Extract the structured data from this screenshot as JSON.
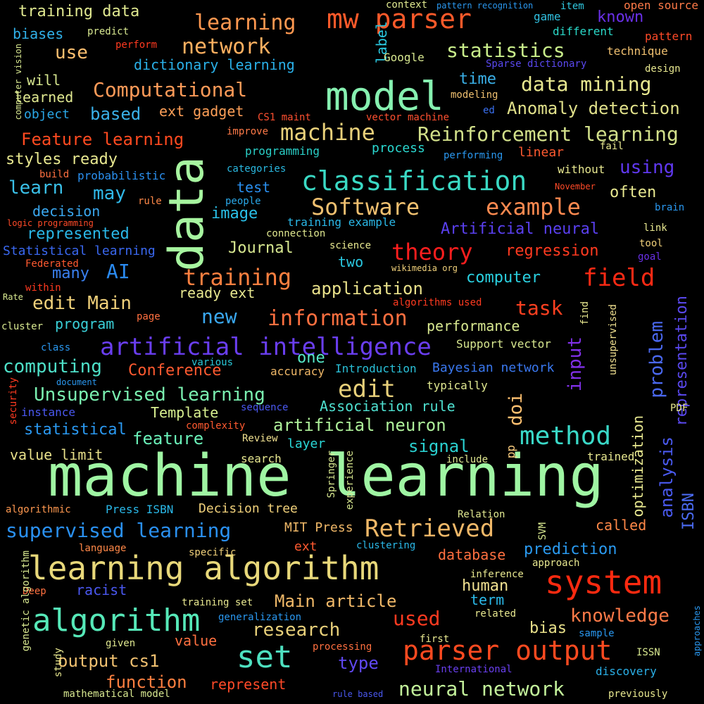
{
  "colors": {
    "background": "#000000"
  },
  "words": [
    {
      "text": "machine learning",
      "color": "#9ff5a3"
    },
    {
      "text": "data",
      "color": "#a7f5a0"
    },
    {
      "text": "model",
      "color": "#86f0b0"
    },
    {
      "text": "learning algorithm",
      "color": "#e8d87a"
    },
    {
      "text": "system",
      "color": "#ff2a10"
    },
    {
      "text": "algorithm",
      "color": "#56e8b8"
    },
    {
      "text": "parser output",
      "color": "#ff4a20"
    },
    {
      "text": "classification",
      "color": "#3ad9c4"
    },
    {
      "text": "artificial intelligence",
      "color": "#6a3ef0"
    },
    {
      "text": "mw parser",
      "color": "#ff5a2a"
    },
    {
      "text": "Software",
      "color": "#f0c070"
    },
    {
      "text": "example",
      "color": "#ff8a50"
    },
    {
      "text": "machine",
      "color": "#e8d07a"
    },
    {
      "text": "Reinforcement learning",
      "color": "#d2e08a"
    },
    {
      "text": "set",
      "color": "#4ee0c0"
    },
    {
      "text": "Retrieved",
      "color": "#f0b868"
    },
    {
      "text": "method",
      "color": "#3ad9c8"
    },
    {
      "text": "theory",
      "color": "#ff1e1e"
    },
    {
      "text": "field",
      "color": "#ff2a14"
    },
    {
      "text": "training",
      "color": "#ff8040"
    },
    {
      "text": "information",
      "color": "#ff7040"
    },
    {
      "text": "edit",
      "color": "#e8d07a"
    },
    {
      "text": "supervised learning",
      "color": "#2a90f0"
    },
    {
      "text": "Unsupervised learning",
      "color": "#7af0b0"
    },
    {
      "text": "learning",
      "color": "#ff9850"
    },
    {
      "text": "network",
      "color": "#ffb060"
    },
    {
      "text": "statistics",
      "color": "#c8ec8a"
    },
    {
      "text": "data mining",
      "color": "#e8e890"
    },
    {
      "text": "Computational",
      "color": "#ff9a58"
    },
    {
      "text": "neural network",
      "color": "#c2f09a"
    },
    {
      "text": "research",
      "color": "#e8d07a"
    },
    {
      "text": "knowledge",
      "color": "#ff7a48"
    },
    {
      "text": "Main article",
      "color": "#f0b868"
    },
    {
      "text": "output cs1",
      "color": "#f0c070"
    },
    {
      "text": "function",
      "color": "#ff8040"
    },
    {
      "text": "computing",
      "color": "#4ee0c8"
    },
    {
      "text": "edit Main",
      "color": "#f0d07a"
    },
    {
      "text": "artificial neuron",
      "color": "#aef09a"
    },
    {
      "text": "feature",
      "color": "#6af0b8"
    },
    {
      "text": "Anomaly detection",
      "color": "#e0e08a"
    },
    {
      "text": "Feature learning",
      "color": "#ff4a20"
    },
    {
      "text": "application",
      "color": "#e8e08a"
    },
    {
      "text": "Journal",
      "color": "#d8e890"
    },
    {
      "text": "task",
      "color": "#ff4020"
    },
    {
      "text": "representation",
      "color": "#5a48ee"
    },
    {
      "text": "problem",
      "color": "#4a68f0"
    },
    {
      "text": "analysis",
      "color": "#4a5af0"
    },
    {
      "text": "input",
      "color": "#8030e8"
    },
    {
      "text": "used",
      "color": "#ff3a20"
    },
    {
      "text": "regression",
      "color": "#ff3a20"
    },
    {
      "text": "performance",
      "color": "#d8e890"
    },
    {
      "text": "doi",
      "color": "#ffc070"
    },
    {
      "text": "AI",
      "color": "#2a8af0"
    },
    {
      "text": "prediction",
      "color": "#2a9af0"
    },
    {
      "text": "human",
      "color": "#f0e090"
    },
    {
      "text": "bias",
      "color": "#e8e08a"
    },
    {
      "text": "computer",
      "color": "#2ad0e0"
    },
    {
      "text": "ISBN",
      "color": "#4a6af0"
    },
    {
      "text": "training data",
      "color": "#e0e890"
    },
    {
      "text": "use",
      "color": "#ffc070"
    },
    {
      "text": "learn",
      "color": "#3ac0e8"
    },
    {
      "text": "may",
      "color": "#30b8e8"
    },
    {
      "text": "based",
      "color": "#3ab0e8"
    },
    {
      "text": "using",
      "color": "#6038f0"
    },
    {
      "text": "often",
      "color": "#e8e890"
    },
    {
      "text": "statistical",
      "color": "#2a98f0"
    },
    {
      "text": "signal",
      "color": "#2ad0d0"
    },
    {
      "text": "layer",
      "color": "#2ad8d8"
    },
    {
      "text": "value limit",
      "color": "#e8e08a"
    },
    {
      "text": "Template",
      "color": "#d8f090"
    },
    {
      "text": "Association rule",
      "color": "#4ee0d0"
    },
    {
      "text": "Artificial neural",
      "color": "#5a40f0"
    },
    {
      "text": "decision",
      "color": "#3aa8f0"
    },
    {
      "text": "represented",
      "color": "#2ab8e8"
    },
    {
      "text": "image",
      "color": "#2ac0e8"
    },
    {
      "text": "new",
      "color": "#3aa8f0"
    },
    {
      "text": "one",
      "color": "#56e8c8"
    },
    {
      "text": "Conference",
      "color": "#ff5a30"
    },
    {
      "text": "many",
      "color": "#3a80f0"
    },
    {
      "text": "two",
      "color": "#2ac8e0"
    },
    {
      "text": "test",
      "color": "#2a90f0"
    },
    {
      "text": "program",
      "color": "#3ad0d8"
    },
    {
      "text": "time",
      "color": "#3ab0e8"
    },
    {
      "text": "ext gadget",
      "color": "#ffa058"
    },
    {
      "text": "styles ready",
      "color": "#e8e890"
    },
    {
      "text": "ready ext",
      "color": "#e8e890"
    },
    {
      "text": "term",
      "color": "#2ab8e8"
    },
    {
      "text": "type",
      "color": "#6048f0"
    },
    {
      "text": "value",
      "color": "#ff7040"
    },
    {
      "text": "called",
      "color": "#ff8848"
    },
    {
      "text": "database",
      "color": "#ff7040"
    },
    {
      "text": "Bayesian network",
      "color": "#3a78f0"
    },
    {
      "text": "optimization",
      "color": "#e8e890"
    },
    {
      "text": "represent",
      "color": "#ff4a28"
    },
    {
      "text": "process",
      "color": "#2ad8d0"
    },
    {
      "text": "biases",
      "color": "#30b0e8"
    },
    {
      "text": "learned",
      "color": "#e0e890"
    },
    {
      "text": "will",
      "color": "#d8e890"
    },
    {
      "text": "label",
      "color": "#2ac8e0"
    },
    {
      "text": "known",
      "color": "#6a30e8"
    },
    {
      "text": "linear",
      "color": "#ff5a30"
    },
    {
      "text": "dictionary learning",
      "color": "#2ab0e8"
    },
    {
      "text": "Decision tree",
      "color": "#f0d07a"
    },
    {
      "text": "Press ISBN",
      "color": "#2ab8e8"
    },
    {
      "text": "MIT Press",
      "color": "#f0b868"
    },
    {
      "text": "ext",
      "color": "#ff5a30"
    },
    {
      "text": "object",
      "color": "#2aa8e8"
    },
    {
      "text": "racist",
      "color": "#4a58f0"
    },
    {
      "text": "accuracy",
      "color": "#f0b868"
    },
    {
      "text": "typically",
      "color": "#e0e890"
    },
    {
      "text": "Google",
      "color": "#d8e890"
    },
    {
      "text": "discovery",
      "color": "#2ab0e8"
    },
    {
      "text": "training example",
      "color": "#2ab8e8"
    },
    {
      "text": "Support vector",
      "color": "#d8e890"
    },
    {
      "text": "Introduction",
      "color": "#2ac0d8"
    },
    {
      "text": "programming",
      "color": "#2ad0c8"
    },
    {
      "text": "Statistical learning",
      "color": "#3a68f0"
    },
    {
      "text": "probabilistic",
      "color": "#2a90f0"
    },
    {
      "text": "instance",
      "color": "#4a58f0"
    },
    {
      "text": "Springer",
      "color": "#d8e890"
    },
    {
      "text": "experience",
      "color": "#d8e890"
    },
    {
      "text": "search",
      "color": "#e8e890"
    },
    {
      "text": "include",
      "color": "#e0e890"
    },
    {
      "text": "pp",
      "color": "#ffd080"
    },
    {
      "text": "trained",
      "color": "#e8e890"
    },
    {
      "text": "unsupervised",
      "color": "#f0e090"
    },
    {
      "text": "open source",
      "color": "#ff7a48"
    },
    {
      "text": "pattern",
      "color": "#ff4a28"
    },
    {
      "text": "technique",
      "color": "#f0c070"
    },
    {
      "text": "design",
      "color": "#e8e890"
    },
    {
      "text": "item",
      "color": "#30c8e0"
    },
    {
      "text": "game",
      "color": "#30c0e0"
    },
    {
      "text": "different",
      "color": "#2ad8c8"
    },
    {
      "text": "context",
      "color": "#e0e890"
    },
    {
      "text": "pattern recognition",
      "color": "#2a98f0"
    },
    {
      "text": "Sparse dictionary",
      "color": "#5a48f0"
    },
    {
      "text": "modeling",
      "color": "#f0c070"
    },
    {
      "text": "ed",
      "color": "#3a70f0"
    },
    {
      "text": "vector machine",
      "color": "#ff5030"
    },
    {
      "text": "CS1 maint",
      "color": "#ff5030"
    },
    {
      "text": "improve",
      "color": "#ff7a48"
    },
    {
      "text": "performing",
      "color": "#2a98f0"
    },
    {
      "text": "fail",
      "color": "#e8e890"
    },
    {
      "text": "without",
      "color": "#e8e890"
    },
    {
      "text": "November",
      "color": "#ff4a28"
    },
    {
      "text": "brain",
      "color": "#2a98f0"
    },
    {
      "text": "link",
      "color": "#e8e890"
    },
    {
      "text": "tool",
      "color": "#f0d07a"
    },
    {
      "text": "goal",
      "color": "#6a30e8"
    },
    {
      "text": "people",
      "color": "#2aa8e8"
    },
    {
      "text": "categories",
      "color": "#2ab8e0"
    },
    {
      "text": "connection",
      "color": "#e0e890"
    },
    {
      "text": "science",
      "color": "#e8e890"
    },
    {
      "text": "wikimedia org",
      "color": "#f0d07a"
    },
    {
      "text": "algorithms used",
      "color": "#ff3a20"
    },
    {
      "text": "find",
      "color": "#e8e890"
    },
    {
      "text": "rule",
      "color": "#ff8848"
    },
    {
      "text": "build",
      "color": "#ff7040"
    },
    {
      "text": "logic programming",
      "color": "#ff4a28"
    },
    {
      "text": "Federated",
      "color": "#ff5a30"
    },
    {
      "text": "within",
      "color": "#ff3a20"
    },
    {
      "text": "Rate",
      "color": "#d8e890"
    },
    {
      "text": "page",
      "color": "#ff7040"
    },
    {
      "text": "cluster",
      "color": "#d8e890"
    },
    {
      "text": "class",
      "color": "#2a98f0"
    },
    {
      "text": "various",
      "color": "#2ac8d8"
    },
    {
      "text": "document",
      "color": "#2a98f0"
    },
    {
      "text": "security",
      "color": "#ff3a20"
    },
    {
      "text": "sequence",
      "color": "#4a58f0"
    },
    {
      "text": "complexity",
      "color": "#ff5a30"
    },
    {
      "text": "Review",
      "color": "#f0e090"
    },
    {
      "text": "PDF",
      "color": "#e8e890"
    },
    {
      "text": "algorithmic",
      "color": "#ff9850"
    },
    {
      "text": "Relation",
      "color": "#e0e890"
    },
    {
      "text": "SVM",
      "color": "#d8e890"
    },
    {
      "text": "language",
      "color": "#ff8848"
    },
    {
      "text": "specific",
      "color": "#f0d07a"
    },
    {
      "text": "clustering",
      "color": "#2ab8e8"
    },
    {
      "text": "approach",
      "color": "#e8e890"
    },
    {
      "text": "inference",
      "color": "#e8e890"
    },
    {
      "text": "Deep",
      "color": "#ff7040"
    },
    {
      "text": "training set",
      "color": "#e8e890"
    },
    {
      "text": "generalization",
      "color": "#2a98f0"
    },
    {
      "text": "related",
      "color": "#e8e890"
    },
    {
      "text": "sample",
      "color": "#2a98f0"
    },
    {
      "text": "first",
      "color": "#e8e890"
    },
    {
      "text": "given",
      "color": "#e0e890"
    },
    {
      "text": "processing",
      "color": "#ff7040"
    },
    {
      "text": "ISSN",
      "color": "#d8e890"
    },
    {
      "text": "International",
      "color": "#6a40f0"
    },
    {
      "text": "genetic algorithm",
      "color": "#d8e890"
    },
    {
      "text": "study",
      "color": "#e8e890"
    },
    {
      "text": "mathematical model",
      "color": "#d8e890"
    },
    {
      "text": "rule based",
      "color": "#4a58f0"
    },
    {
      "text": "previously",
      "color": "#e8e890"
    },
    {
      "text": "approaches",
      "color": "#2a98f0"
    },
    {
      "text": "computer vision",
      "color": "#d8e890"
    },
    {
      "text": "predict",
      "color": "#d8e890"
    },
    {
      "text": "perform",
      "color": "#ff3a20"
    }
  ]
}
